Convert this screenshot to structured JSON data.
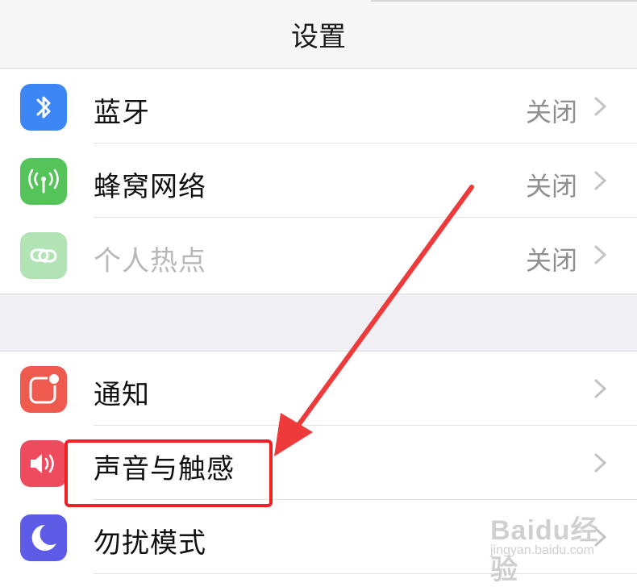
{
  "header": {
    "title": "设置"
  },
  "group1": [
    {
      "label": "蓝牙",
      "value": "关闭",
      "icon": "bluetooth-icon",
      "color": "#3d86f5"
    },
    {
      "label": "蜂窝网络",
      "value": "关闭",
      "icon": "cellular-icon",
      "color": "#54c35a"
    },
    {
      "label": "个人热点",
      "value": "关闭",
      "icon": "hotspot-icon",
      "color": "#54c35a"
    }
  ],
  "group2": [
    {
      "label": "通知",
      "icon": "notifications-icon",
      "color": "#ef5a4f"
    },
    {
      "label": "声音与触感",
      "icon": "sound-icon",
      "color": "#ee4b5e"
    },
    {
      "label": "勿扰模式",
      "icon": "moon-icon",
      "color": "#5e5ce6"
    }
  ],
  "annotation": {
    "color": "#ee2222"
  },
  "watermark": {
    "brand": "Baidu经验",
    "url": "jingyan.baidu.com"
  }
}
